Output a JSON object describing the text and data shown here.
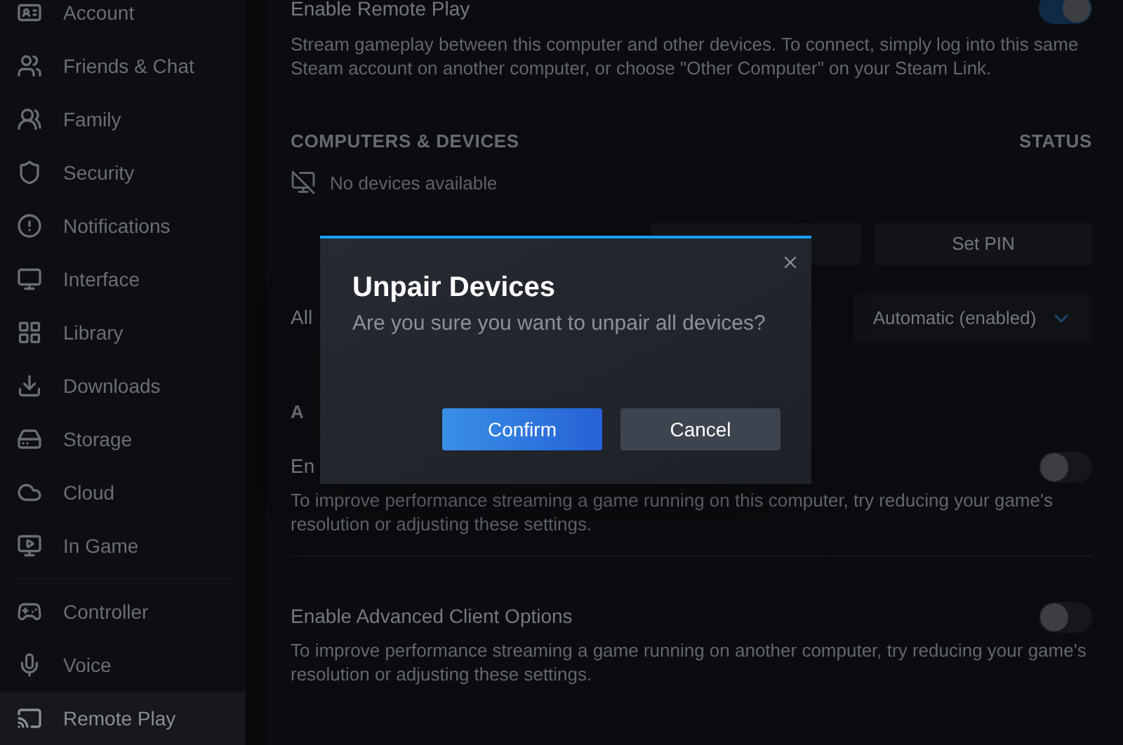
{
  "sidebar": {
    "groups": [
      {
        "items": [
          {
            "label": "Account",
            "selected": false
          },
          {
            "label": "Friends & Chat",
            "selected": false
          },
          {
            "label": "Family",
            "selected": false
          },
          {
            "label": "Security",
            "selected": false
          },
          {
            "label": "Notifications",
            "selected": false
          },
          {
            "label": "Interface",
            "selected": false
          },
          {
            "label": "Library",
            "selected": false
          },
          {
            "label": "Downloads",
            "selected": false
          },
          {
            "label": "Storage",
            "selected": false
          },
          {
            "label": "Cloud",
            "selected": false
          },
          {
            "label": "In Game",
            "selected": false
          }
        ]
      },
      {
        "items": [
          {
            "label": "Controller",
            "selected": false
          },
          {
            "label": "Voice",
            "selected": false
          },
          {
            "label": "Remote Play",
            "selected": true
          }
        ]
      }
    ]
  },
  "remote_play": {
    "label": "Enable Remote Play",
    "on": true,
    "description": "Stream gameplay between this computer and other devices. To connect, simply log into this same Steam account on another computer, or choose \"Other Computer\" on your Steam Link."
  },
  "devices": {
    "header": "COMPUTERS & DEVICES",
    "status_header": "STATUS",
    "empty_text": "No devices available",
    "pin_button": "Set PIN"
  },
  "partial_row": {
    "label": "All",
    "dropdown": "Automatic (enabled)"
  },
  "partial_header": "A",
  "settings": [
    {
      "label": "En",
      "on": false,
      "description": "To improve performance streaming a game running on this computer, try reducing your game's resolution or adjusting these settings."
    },
    {
      "label": "Enable Advanced Client Options",
      "on": false,
      "description": "To improve performance streaming a game running on another computer, try reducing your game's resolution or adjusting these settings."
    }
  ],
  "dialog": {
    "title": "Unpair Devices",
    "message": "Are you sure you want to unpair all devices?",
    "confirm": "Confirm",
    "cancel": "Cancel"
  }
}
